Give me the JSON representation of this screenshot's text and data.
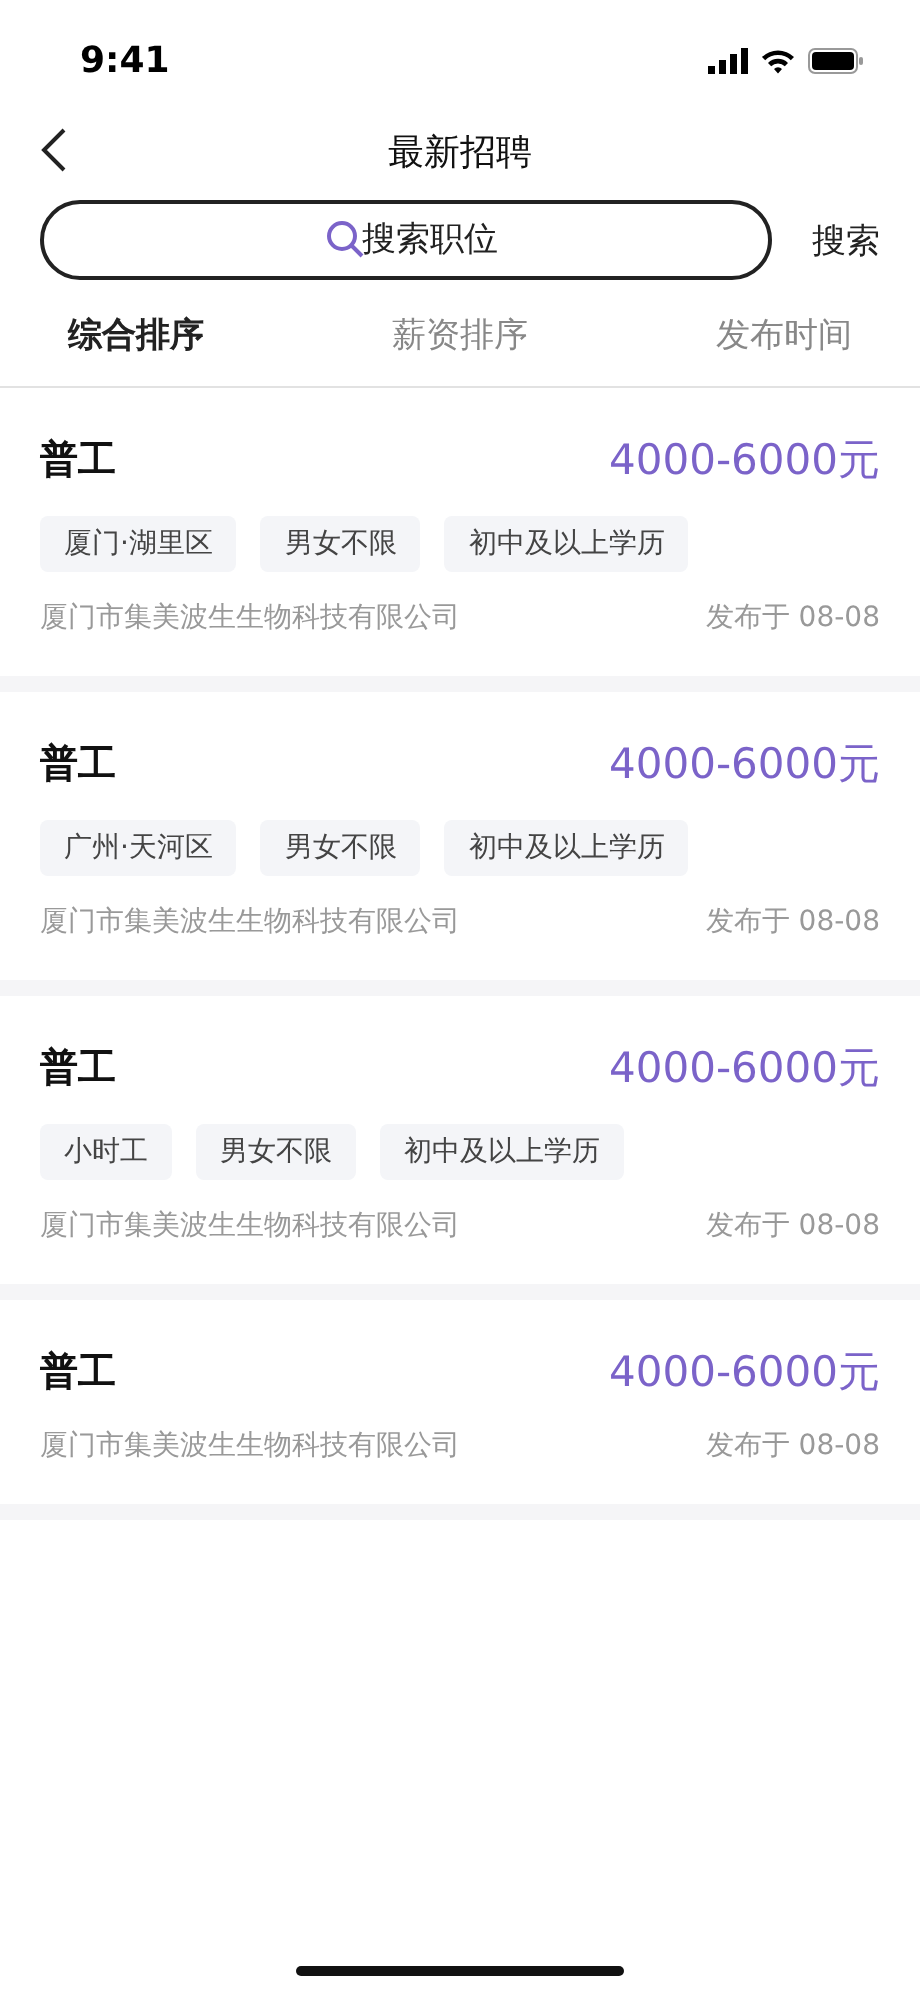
{
  "status_bar": {
    "time": "9:41"
  },
  "header": {
    "title": "最新招聘"
  },
  "search": {
    "placeholder": "搜索职位",
    "button": "搜索"
  },
  "sort_tabs": [
    {
      "label": "综合排序",
      "selected": true
    },
    {
      "label": "薪资排序",
      "selected": false
    },
    {
      "label": "发布时间",
      "selected": false
    }
  ],
  "jobs": [
    {
      "title": "普工",
      "salary": "4000-6000元",
      "tags": [
        "厦门·湖里区",
        "男女不限",
        "初中及以上学历"
      ],
      "company": "厦门市集美波生生物科技有限公司",
      "posted": "发布于 08-08"
    },
    {
      "title": "普工",
      "salary": "4000-6000元",
      "tags": [
        "广州·天河区",
        "男女不限",
        "初中及以上学历"
      ],
      "company": "厦门市集美波生生物科技有限公司",
      "posted": "发布于 08-08"
    },
    {
      "title": "普工",
      "salary": "4000-6000元",
      "tags": [
        "小时工",
        "男女不限",
        "初中及以上学历"
      ],
      "company": "厦门市集美波生生物科技有限公司",
      "posted": "发布于 08-08"
    },
    {
      "title": "普工",
      "salary": "4000-6000元",
      "company": "厦门市集美波生生物科技有限公司",
      "posted": "发布于 08-08"
    }
  ]
}
